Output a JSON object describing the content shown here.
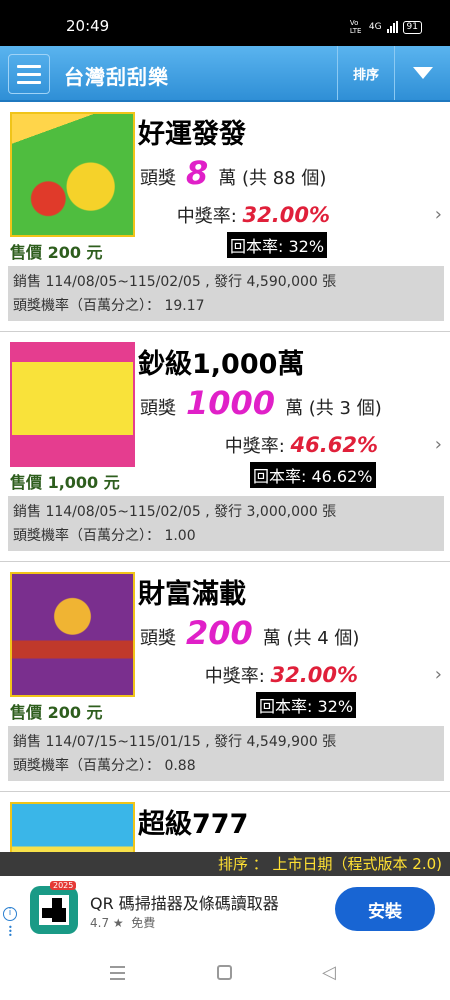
{
  "status": {
    "time": "20:49",
    "net": "Vo LTE",
    "net_type": "4G",
    "battery": "91"
  },
  "header": {
    "title": "台灣刮刮樂",
    "sort_label": "排序"
  },
  "cards": [
    {
      "name": "好運發發",
      "prize_label": "頭獎",
      "prize_amount": "8",
      "prize_unit": "萬 (共 88 個)",
      "win_label": "中獎率:",
      "win_rate": "32.00%",
      "return_rate": "回本率: 32%",
      "price": "售價 200 元",
      "sales": "銷售 114/08/05~115/02/05 , 發行 4,590,000 張",
      "odds": "頭獎機率（百萬分之）： 19.17",
      "thumb_colors": [
        "#4fbd3f",
        "#f5d22a"
      ]
    },
    {
      "name": "鈔級1,000萬",
      "prize_label": "頭獎",
      "prize_amount": "1000",
      "prize_unit": "萬 (共 3 個)",
      "win_label": "中獎率:",
      "win_rate": "46.62%",
      "return_rate": "回本率: 46.62%",
      "price": "售價 1,000 元",
      "sales": "銷售 114/08/05~115/02/05 , 發行 3,000,000 張",
      "odds": "頭獎機率（百萬分之）： 1.00",
      "thumb_colors": [
        "#e53d8f",
        "#f3a6c9"
      ]
    },
    {
      "name": "財富滿載",
      "prize_label": "頭獎",
      "prize_amount": "200",
      "prize_unit": "萬 (共 4 個)",
      "win_label": "中獎率:",
      "win_rate": "32.00%",
      "return_rate": "回本率: 32%",
      "price": "售價 200 元",
      "sales": "銷售 114/07/15~115/01/15 , 發行 4,549,900 張",
      "odds": "頭獎機率（百萬分之）： 0.88",
      "thumb_colors": [
        "#7a2f8e",
        "#f0b433"
      ]
    },
    {
      "name": "超級777",
      "thumb_colors": [
        "#3ab6e8",
        "#f7e14a"
      ]
    }
  ],
  "footer": {
    "sort_status": "排序 ： 上市日期（程式版本 2.0)"
  },
  "ad": {
    "badge": "2025",
    "title": "QR 碼掃描器及條碼讀取器",
    "rating": "4.7 ★",
    "price": "免費",
    "install": "安裝"
  }
}
